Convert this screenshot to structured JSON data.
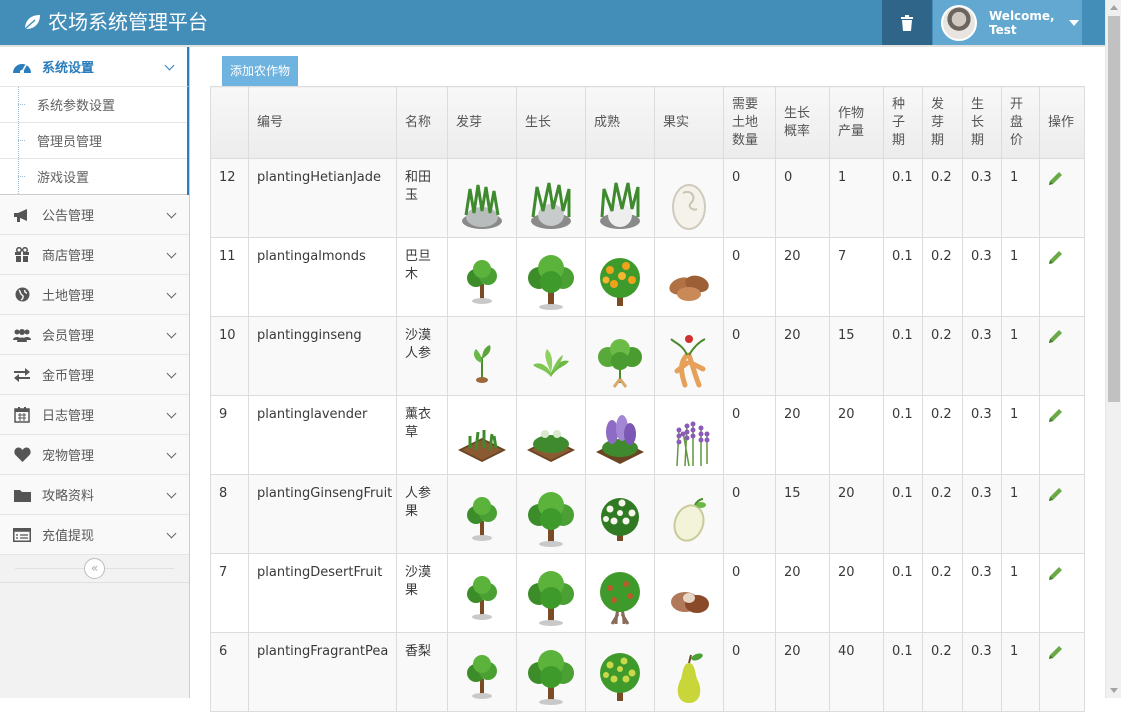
{
  "app": {
    "title": "农场系统管理平台",
    "welcome": "Welcome,",
    "username": "Test"
  },
  "sidebar": {
    "active": {
      "label": "系统设置",
      "icon": "dashboard-icon"
    },
    "subitems": [
      {
        "label": "系统参数设置"
      },
      {
        "label": "管理员管理"
      },
      {
        "label": "游戏设置"
      }
    ],
    "items": [
      {
        "label": "公告管理",
        "icon": "bullhorn-icon"
      },
      {
        "label": "商店管理",
        "icon": "gift-icon"
      },
      {
        "label": "土地管理",
        "icon": "globe-icon"
      },
      {
        "label": "会员管理",
        "icon": "users-icon"
      },
      {
        "label": "金币管理",
        "icon": "exchange-icon"
      },
      {
        "label": "日志管理",
        "icon": "calendar-icon"
      },
      {
        "label": "宠物管理",
        "icon": "heart-icon"
      },
      {
        "label": "攻略资料",
        "icon": "folder-icon"
      },
      {
        "label": "充值提现",
        "icon": "list-icon"
      }
    ],
    "collapse_glyph": "«"
  },
  "main": {
    "add_button": "添加农作物",
    "columns": [
      "",
      "编号",
      "名称",
      "发芽",
      "生长",
      "成熟",
      "果实",
      "需要土地数量",
      "生长概率",
      "作物产量",
      "种子期",
      "发芽期",
      "生长期",
      "开盘价",
      "操作"
    ],
    "rows": [
      {
        "id": "12",
        "code": "plantingHetianJade",
        "name": "和田玉",
        "land": "0",
        "prob": "0",
        "yield": "1",
        "seed": "0.1",
        "sprout": "0.2",
        "grow": "0.3",
        "price": "1",
        "images": [
          "jade-sprout",
          "jade-grow",
          "jade-ripe",
          "jade-fruit"
        ]
      },
      {
        "id": "11",
        "code": "plantingalmonds",
        "name": "巴旦木",
        "land": "0",
        "prob": "20",
        "yield": "7",
        "seed": "0.1",
        "sprout": "0.2",
        "grow": "0.3",
        "price": "1",
        "images": [
          "sapling",
          "tree",
          "orange-tree",
          "almonds"
        ]
      },
      {
        "id": "10",
        "code": "plantingginseng",
        "name": "沙漠人参",
        "land": "0",
        "prob": "20",
        "yield": "15",
        "seed": "0.1",
        "sprout": "0.2",
        "grow": "0.3",
        "price": "1",
        "images": [
          "seedling",
          "leafy",
          "ginseng-plant",
          "ginseng-root"
        ]
      },
      {
        "id": "9",
        "code": "plantinglavender",
        "name": "薰衣草",
        "land": "0",
        "prob": "20",
        "yield": "20",
        "seed": "0.1",
        "sprout": "0.2",
        "grow": "0.3",
        "price": "1",
        "images": [
          "bed-sprout",
          "bed-grow",
          "bed-flower",
          "lavender"
        ]
      },
      {
        "id": "8",
        "code": "plantingGinsengFruit",
        "name": "人参果",
        "land": "0",
        "prob": "15",
        "yield": "20",
        "seed": "0.1",
        "sprout": "0.2",
        "grow": "0.3",
        "price": "1",
        "images": [
          "sapling",
          "tree",
          "flower-bush",
          "pale-fruit"
        ]
      },
      {
        "id": "7",
        "code": "plantingDesertFruit",
        "name": "沙漠果",
        "land": "0",
        "prob": "20",
        "yield": "20",
        "seed": "0.1",
        "sprout": "0.2",
        "grow": "0.3",
        "price": "1",
        "images": [
          "sapling",
          "tree",
          "fruit-tree",
          "brown-fruit"
        ]
      },
      {
        "id": "6",
        "code": "plantingFragrantPea",
        "name": "香梨",
        "land": "0",
        "prob": "20",
        "yield": "40",
        "seed": "0.1",
        "sprout": "0.2",
        "grow": "0.3",
        "price": "1",
        "images": [
          "sapling",
          "tree",
          "pear-tree",
          "pear"
        ]
      }
    ]
  },
  "colors": {
    "navbar": "#438eb9",
    "accent": "#2b7dbc",
    "button": "#6fb3e0",
    "edit": "#69aa46"
  }
}
